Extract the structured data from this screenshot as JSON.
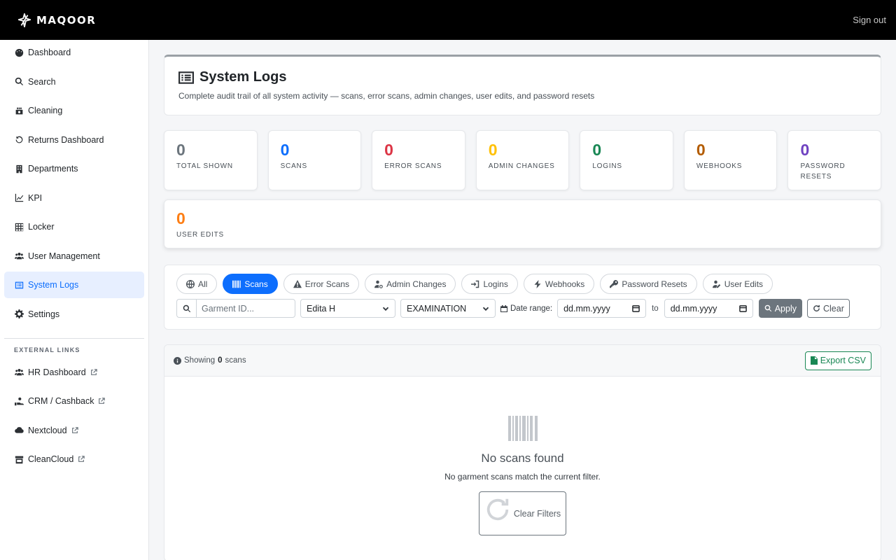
{
  "brand": {
    "name": "MAQOOR"
  },
  "header": {
    "signout": "Sign out"
  },
  "sidebar": {
    "items": [
      {
        "label": "Dashboard"
      },
      {
        "label": "Search"
      },
      {
        "label": "Cleaning"
      },
      {
        "label": "Returns Dashboard"
      },
      {
        "label": "Departments"
      },
      {
        "label": "KPI"
      },
      {
        "label": "Locker"
      },
      {
        "label": "User Management"
      },
      {
        "label": "System Logs",
        "active": true
      },
      {
        "label": "Settings"
      }
    ],
    "external_heading": "EXTERNAL LINKS",
    "external": [
      {
        "label": "HR Dashboard"
      },
      {
        "label": "CRM / Cashback"
      },
      {
        "label": "Nextcloud"
      },
      {
        "label": "CleanCloud"
      }
    ]
  },
  "page": {
    "title": "System Logs",
    "subtitle": "Complete audit trail of all system activity — scans, error scans, admin changes, user edits, and password resets"
  },
  "stats": [
    {
      "value": "0",
      "label": "TOTAL SHOWN",
      "color": "#6c757d"
    },
    {
      "value": "0",
      "label": "SCANS",
      "color": "#0d6efd"
    },
    {
      "value": "0",
      "label": "ERROR SCANS",
      "color": "#dc3545"
    },
    {
      "value": "0",
      "label": "ADMIN CHANGES",
      "color": "#ffc107"
    },
    {
      "value": "0",
      "label": "LOGINS",
      "color": "#198754"
    },
    {
      "value": "0",
      "label": "WEBHOOKS",
      "color": "#b35c00"
    },
    {
      "value": "0",
      "label": "PASSWORD RESETS",
      "color": "#6f42c1"
    },
    {
      "value": "0",
      "label": "USER EDITS",
      "color": "#fd7e14"
    }
  ],
  "filters": {
    "tabs": [
      {
        "label": "All"
      },
      {
        "label": "Scans",
        "active": true
      },
      {
        "label": "Error Scans"
      },
      {
        "label": "Admin Changes"
      },
      {
        "label": "Logins"
      },
      {
        "label": "Webhooks"
      },
      {
        "label": "Password Resets"
      },
      {
        "label": "User Edits"
      }
    ],
    "search_placeholder": "Garment ID...",
    "user_select": "Edita H",
    "stage_select": "EXAMINATION",
    "date_range_label": "Date range:",
    "date_from": "dd.mm.yyyy",
    "to_label": "to",
    "date_to": "dd.mm.yyyy",
    "apply": "Apply",
    "clear": "Clear"
  },
  "results": {
    "showing_prefix": "Showing",
    "count": "0",
    "showing_suffix": "scans",
    "export": "Export CSV",
    "empty_title": "No scans found",
    "empty_sub": "No garment scans match the current filter.",
    "clear_filters": "Clear Filters"
  }
}
